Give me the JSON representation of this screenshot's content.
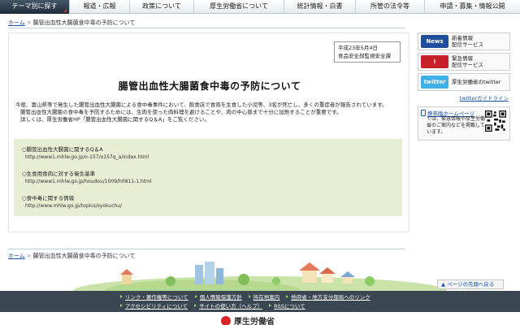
{
  "nav": {
    "items": [
      {
        "label": "テーマ別に探す",
        "active": true
      },
      {
        "label": "報道・広報",
        "active": false
      },
      {
        "label": "政策について",
        "active": false
      },
      {
        "label": "厚生労働省について",
        "active": false
      },
      {
        "label": "統計情報・白書",
        "active": false
      },
      {
        "label": "所管の法令等",
        "active": false
      },
      {
        "label": "申請・募集・情報公開",
        "active": false
      }
    ]
  },
  "breadcrumb": {
    "home": "ホーム",
    "separator": ">",
    "current": "腸管出血性大腸菌食中毒の予防について"
  },
  "datebox": {
    "date": "平成23年5月4日",
    "department": "食品安全部監視安全課"
  },
  "page_title": "腸管出血性大腸菌食中毒の予防について",
  "body": {
    "paragraph1": "今般、富山県等で発生した腸管出血性大腸菌による食中毒事件において、飲食店で食肉を生食した小児等、3名が死亡し、多くの重症者が報告されています。",
    "paragraph2": "腸管出血性大腸菌の食中毒を予防するためには、生肉を使った肉料理を避けることや、肉の中心部まで十分に加熱することが重要です。",
    "paragraph3": "詳しくは、厚生労働省HP「腸管出血性大腸菌に関するQ＆A」をご覧ください。"
  },
  "info_entries": [
    {
      "title": "○腸管出血性大腸菌に関するQ＆A",
      "url": "http://www1.mhlw.go.jp/o-157/o157q_a/index.html"
    },
    {
      "title": "○生食用食肉に対する衛生基準",
      "url": "http://www1.mhlw.go.jp/houdou/1009/h0811-1.html"
    },
    {
      "title": "○食中毒に関する情報",
      "url": "http://www.mhlw.go.jp/topics/syokuchu/"
    }
  ],
  "sidebar": {
    "news": {
      "icon_text": "News",
      "line1": "新着情報",
      "line2": "配信サービス"
    },
    "alert": {
      "line1": "緊急情報",
      "line2": "配信サービス"
    },
    "twitter": {
      "icon_text": "twitter",
      "label": "厚生労働省のtwitter"
    },
    "twitter_guide": "twitterガイドライン",
    "mobile": {
      "title": "携帯版ホームページ",
      "text": "では、緊急情報や厚生労働省のご案内などを掲載しています。"
    }
  },
  "footer": {
    "pagetop": "ページの先頭へ戻る",
    "row1": [
      "リンク・著作権等について",
      "個人情報保護方針",
      "所在地案内",
      "他府省・地方支分部局へのリンク"
    ],
    "row2": [
      "アクセシビリティについて",
      "サイトの使い方（ヘルプ）",
      "RSSについて"
    ],
    "logo_text": "厚生労働省"
  },
  "colors": {
    "nav_active": "#1f2d3a",
    "link": "#1a55a8",
    "infobox": "#e6efd4",
    "footer": "#3a4652",
    "accent_red": "#d8262b"
  }
}
